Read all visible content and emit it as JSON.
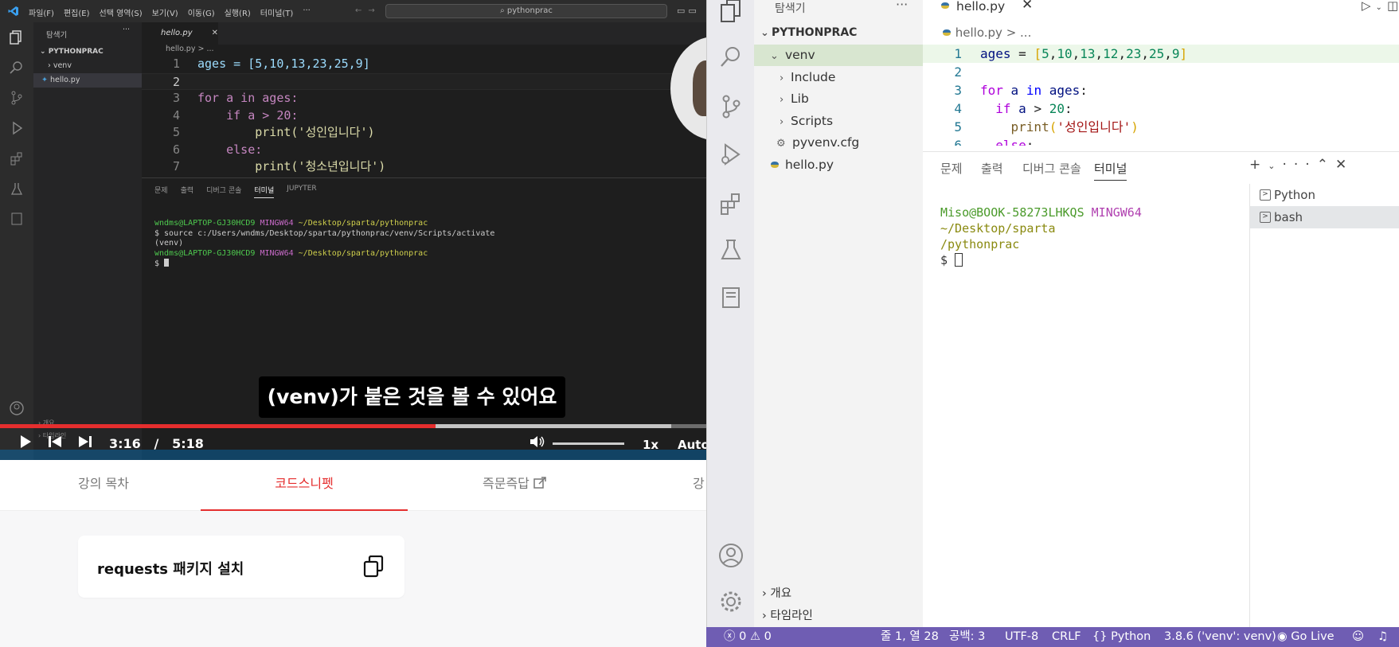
{
  "video": {
    "vscode": {
      "menus": [
        "파일(F)",
        "편집(E)",
        "선택 영역(S)",
        "보기(V)",
        "이동(G)",
        "실행(R)",
        "터미널(T)",
        "···"
      ],
      "search": "pythonprac",
      "explorer_title": "탐색기",
      "root": "PYTHONPRAC",
      "files": [
        "venv",
        "hello.py"
      ],
      "bottom_sections": [
        "개요",
        "타임라인"
      ],
      "tab": "hello.py",
      "breadcrumb": "hello.py > ...",
      "code": [
        {
          "n": "1",
          "t": "ages = [5,10,13,23,25,9]"
        },
        {
          "n": "2",
          "t": ""
        },
        {
          "n": "3",
          "t": "for a in ages:"
        },
        {
          "n": "4",
          "t": "    if a > 20:"
        },
        {
          "n": "5",
          "t": "        print('성인입니다')"
        },
        {
          "n": "6",
          "t": "    else:"
        },
        {
          "n": "7",
          "t": "        print('청소년입니다')"
        }
      ],
      "panel_tabs": [
        "문제",
        "출력",
        "디버그 콘솔",
        "터미널",
        "JUPYTER"
      ],
      "terminal": {
        "prompt_user": "wndms@LAPTOP-GJ30HCD9",
        "prompt_env": "MINGW64",
        "prompt_path": "~/Desktop/sparta/pythonprac",
        "command": "$ source c:/Users/wndms/Desktop/sparta/pythonprac/venv/Scripts/activate",
        "venv_line": "(venv)",
        "last_prompt": "$ "
      }
    },
    "caption": "(venv)가 붙은 것을 볼 수 있어요",
    "time_current": "3:16",
    "time_separator": "/",
    "time_total": "5:18",
    "progress": 0.617,
    "buffered": 0.95,
    "rate": "1x",
    "quality": "Auto"
  },
  "lecture_tabs": [
    "강의 목차",
    "코드스니펫",
    "즉문즉답",
    "강"
  ],
  "active_lecture_tab": "코드스니펫",
  "snippet": {
    "title": "requests 패키지 설치"
  },
  "vscode": {
    "explorer_title": "탐색기",
    "explorer_more": "···",
    "root": "PYTHONPRAC",
    "tree": [
      {
        "label": "venv",
        "depth": 1,
        "type": "folder-open"
      },
      {
        "label": "Include",
        "depth": 2,
        "type": "folder"
      },
      {
        "label": "Lib",
        "depth": 2,
        "type": "folder"
      },
      {
        "label": "Scripts",
        "depth": 2,
        "type": "folder"
      },
      {
        "label": "pyvenv.cfg",
        "depth": 2,
        "type": "gear-file"
      },
      {
        "label": "hello.py",
        "depth": 1,
        "type": "python-file"
      }
    ],
    "outline": "개요",
    "timeline": "타임라인",
    "tab": "hello.py",
    "breadcrumb": "hello.py > ...",
    "code_lines": [
      "1",
      "2",
      "3",
      "4",
      "5",
      "6"
    ],
    "panel_tabs": [
      "문제",
      "출력",
      "디버그 콘솔",
      "터미널"
    ],
    "active_panel_tab": "터미널",
    "terminal": {
      "user": "Miso@BOOK-58273LHKQS",
      "env": "MINGW64",
      "path1": "~/Desktop/sparta",
      "path2": "/pythonprac",
      "prompt": "$ "
    },
    "terminal_list": [
      "Python",
      "bash"
    ],
    "status": {
      "errors": "0",
      "warnings": "0",
      "position": "줄 1, 열 28",
      "spaces": "공백: 3",
      "encoding": "UTF-8",
      "eol": "CRLF",
      "language": "Python",
      "interpreter": "3.8.6 ('venv': venv)",
      "live": "Go Live"
    },
    "colors": {
      "status_bar": "#6f5db3",
      "selected_row": "#d8e6d0"
    }
  }
}
